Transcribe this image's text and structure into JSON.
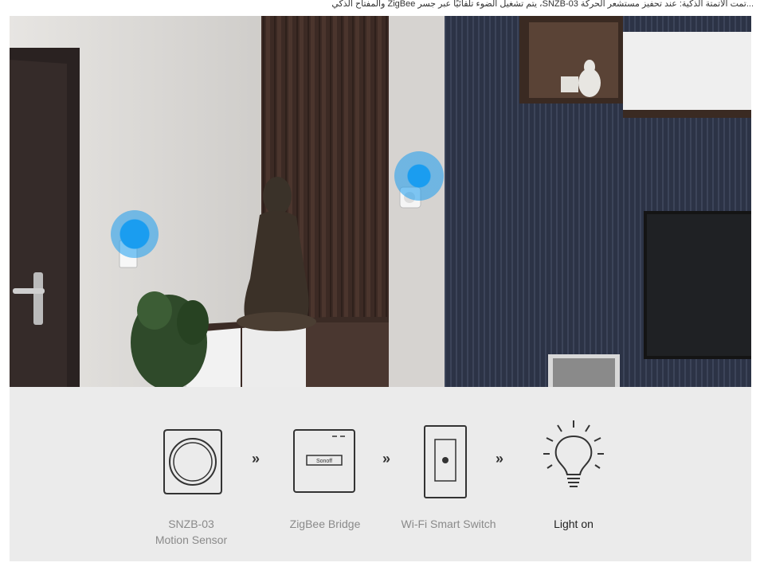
{
  "top_caption": "...تمت الأتمتة الذكية: عند تحفيز مستشعر الحركة SNZB-03، يتم تشغيل الضوء تلقائيًا عبر جسر ZigBee والمفتاح الذكي",
  "flow": {
    "items": [
      {
        "label_line1": "SNZB-03",
        "label_line2": "Motion Sensor"
      },
      {
        "label_line1": "ZigBee Bridge",
        "label_line2": ""
      },
      {
        "label_line1": "Wi-Fi Smart Switch",
        "label_line2": ""
      },
      {
        "label_line1": "Light on",
        "label_line2": ""
      }
    ],
    "arrow_symbol": "»",
    "bridge_brand": "Sonoff"
  },
  "colors": {
    "accent": "#1a9df0",
    "panel_bg": "#ebebeb"
  }
}
